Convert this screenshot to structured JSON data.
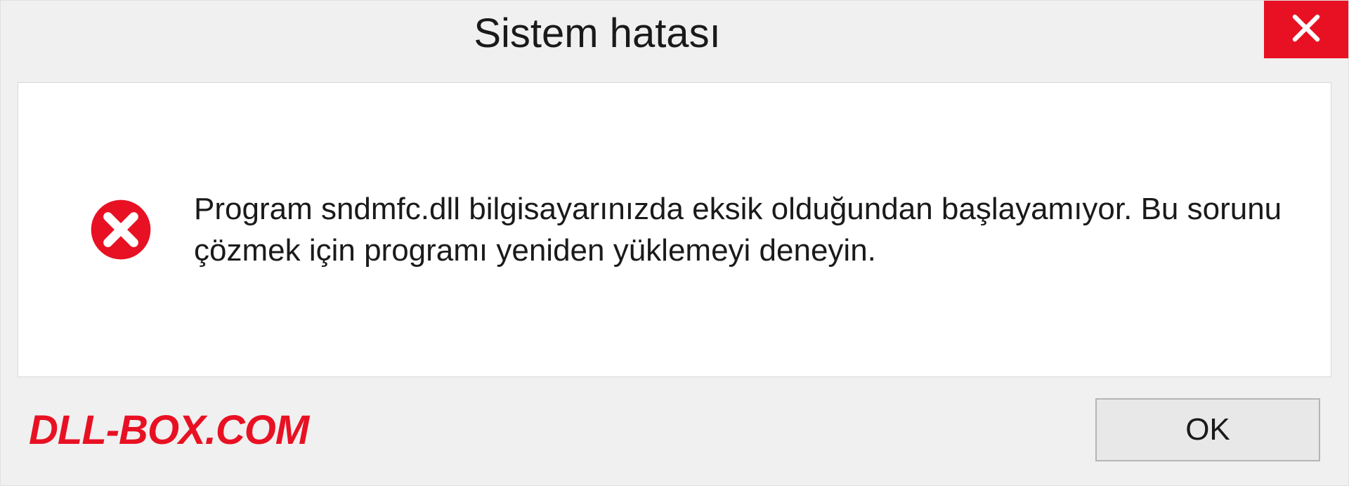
{
  "dialog": {
    "title": "Sistem hatası",
    "message": "Program sndmfc.dll bilgisayarınızda eksik olduğundan başlayamıyor. Bu sorunu çözmek için programı yeniden yüklemeyi deneyin.",
    "ok_label": "OK"
  },
  "watermark": "DLL-BOX.COM",
  "colors": {
    "close_bg": "#e81123",
    "error_icon": "#e81123",
    "watermark": "#e81123"
  }
}
